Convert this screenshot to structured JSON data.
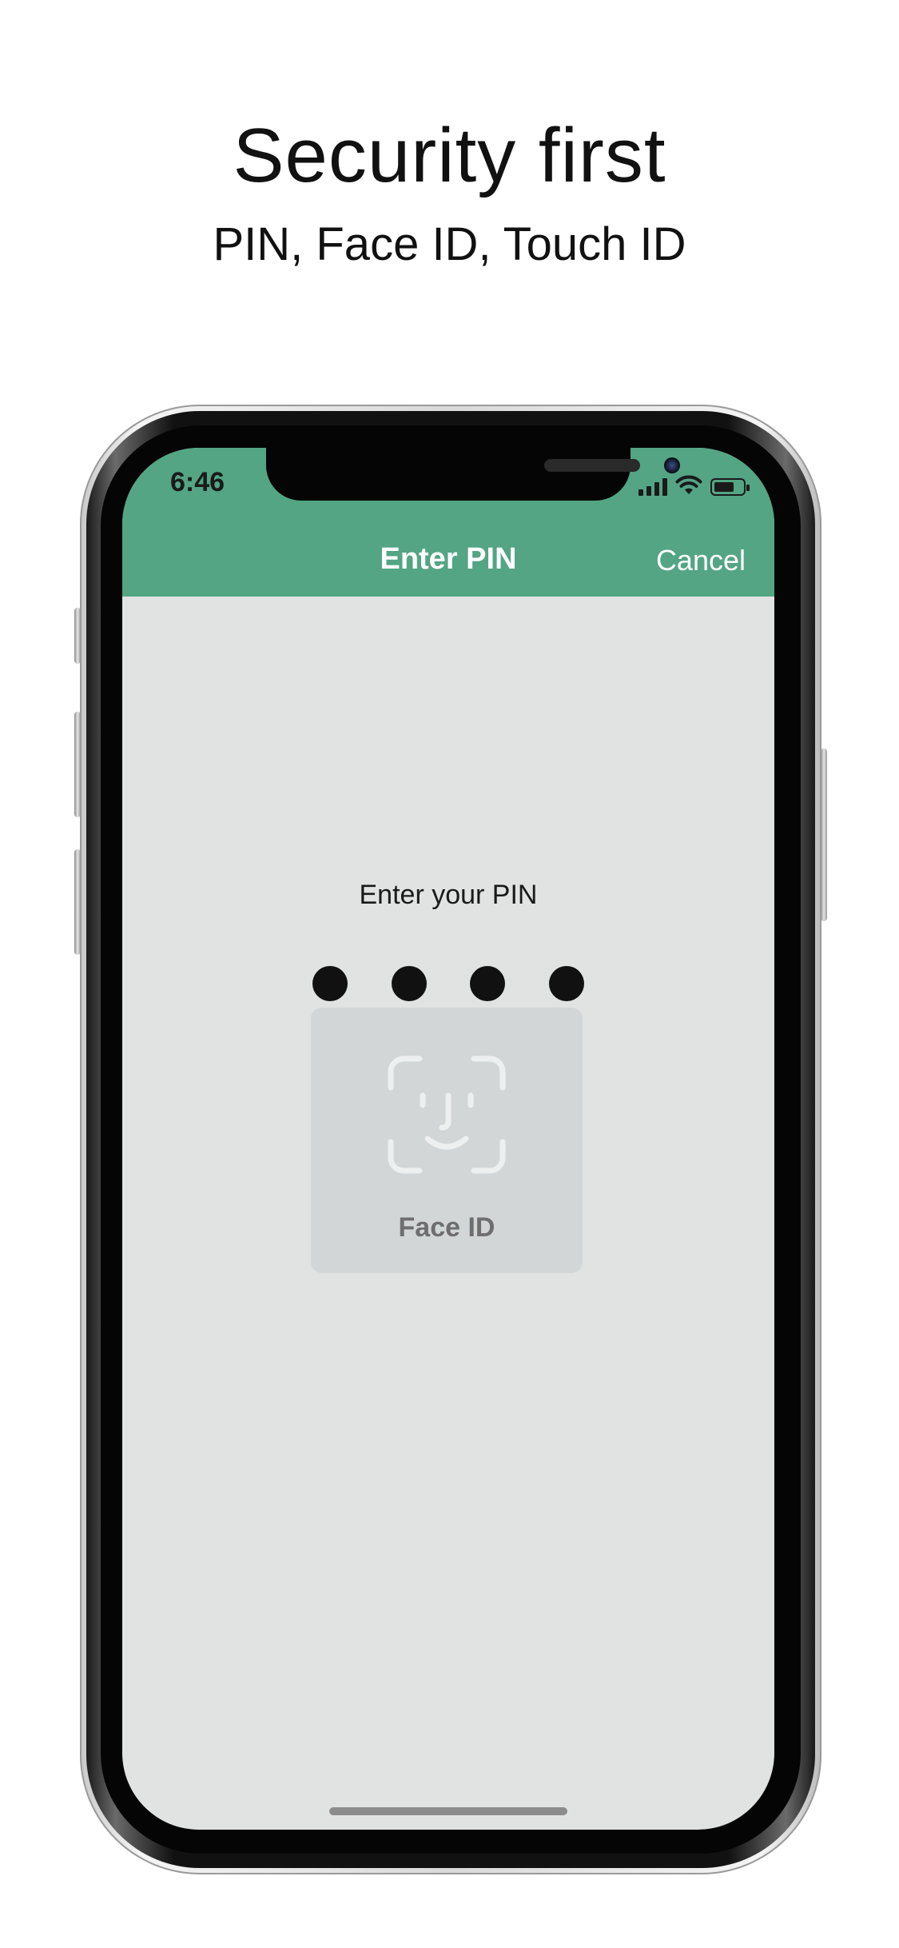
{
  "promo": {
    "title": "Security first",
    "subtitle": "PIN, Face ID, Touch ID"
  },
  "status_bar": {
    "time": "6:46",
    "icons": [
      "cellular-signal-icon",
      "wifi-icon",
      "battery-icon"
    ],
    "battery_level": 0.7
  },
  "nav": {
    "title": "Enter PIN",
    "cancel_label": "Cancel"
  },
  "pin": {
    "prompt": "Enter your PIN",
    "entered_digits": 4,
    "total_digits": 4
  },
  "face_id": {
    "label": "Face ID",
    "icon": "face-id-icon"
  },
  "colors": {
    "header_green": "#53a583",
    "screen_background": "#e1e3e3",
    "face_id_card": "#d2d6d7",
    "pin_dot": "#111111"
  }
}
